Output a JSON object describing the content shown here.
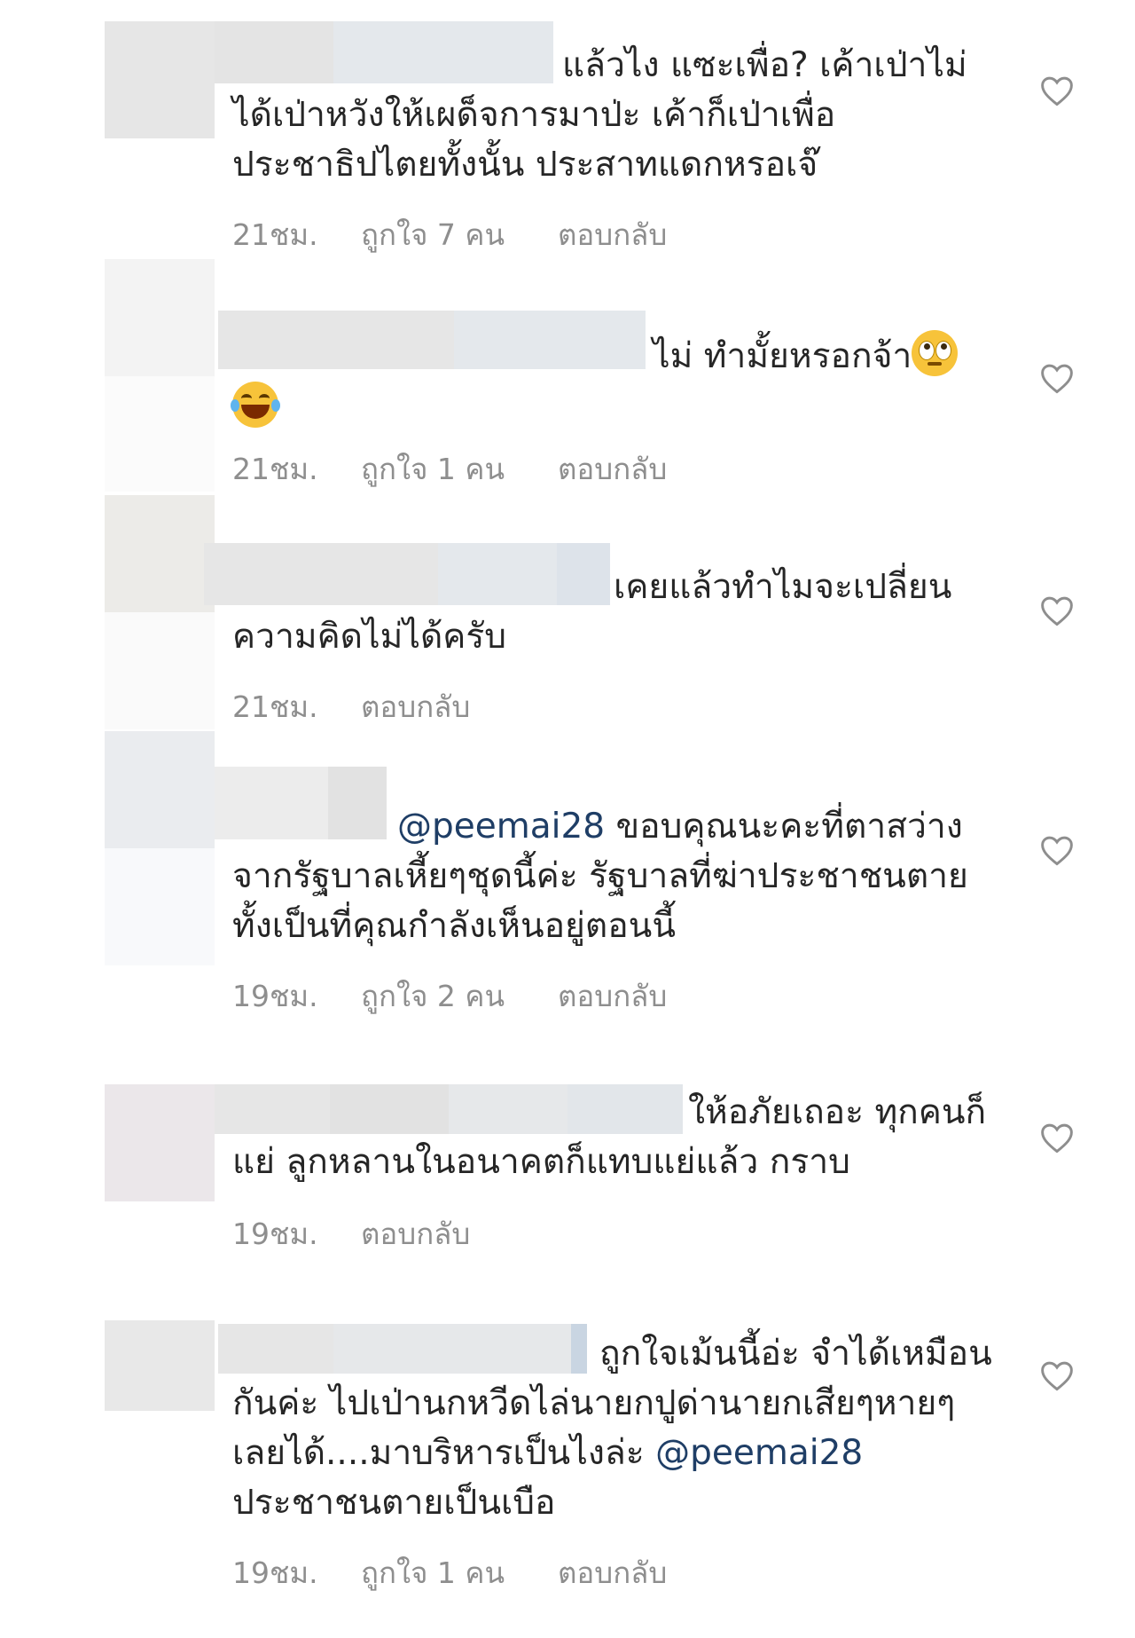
{
  "colors": {
    "text": "#262626",
    "meta": "#8e8e8e",
    "mention": "#1f3e66",
    "heart_outline": "#8e8e8e"
  },
  "comments": [
    {
      "text": "แล้วไง แซะเพื่อ? เค้าเป่าไม่ได้เป่าหวังให้เผด็จการมาป่ะ เค้าก็เป่าเพื่อประชาธิปไตยทั้งนั้น ประสาทแดกหรอเจ๊",
      "time": "21ชม.",
      "likes": "ถูกใจ 7 คน",
      "reply": "ตอบกลับ"
    },
    {
      "text": "ไม่ ทำมั้ยหรอกจ้า",
      "emoji1": "face-with-rolling-eyes",
      "emoji2": "face-with-tears-of-joy",
      "time": "21ชม.",
      "likes": "ถูกใจ 1 คน",
      "reply": "ตอบกลับ"
    },
    {
      "text": "เคยแล้วทำไมจะเปลี่ยนความคิดไม่ได้ครับ",
      "time": "21ชม.",
      "reply": "ตอบกลับ"
    },
    {
      "mention": "@peemai28",
      "text": " ขอบคุณนะคะที่ตาสว่างจากรัฐบาลเหี้ยๆชุดนี้ค่ะ รัฐบาลที่ฆ่าประชาชนตายทั้งเป็นที่คุณกำลังเห็นอยู่ตอนนี้",
      "time": "19ชม.",
      "likes": "ถูกใจ 2 คน",
      "reply": "ตอบกลับ"
    },
    {
      "text": "ให้อภัยเถอะ ทุกคนก็แย่ ลูกหลานในอนาคตก็แทบแย่แล้ว กราบ",
      "time": "19ชม.",
      "reply": "ตอบกลับ"
    },
    {
      "text": "ถูกใจเม้นนี้อ่ะ จำได้เหมือนกันค่ะ ไปเป่านกหวีดไล่นายกปูด่านายกเสียๆหายๆ เลยได้....มาบริหารเป็นไงล่ะ ",
      "mention": "@peemai28",
      "text_after": " ประชาชนตายเป็นเบือ",
      "time": "19ชม.",
      "likes": "ถูกใจ 1 คน",
      "reply": "ตอบกลับ"
    }
  ]
}
